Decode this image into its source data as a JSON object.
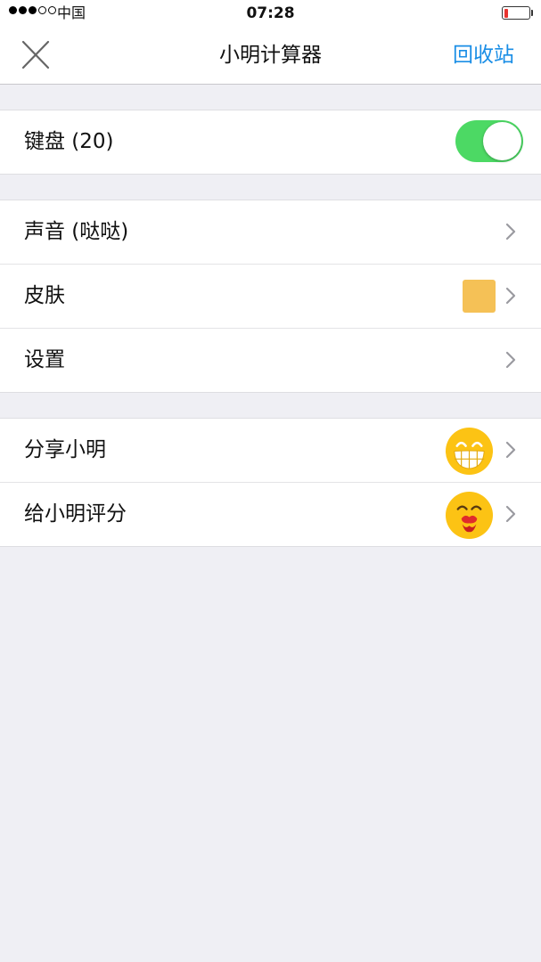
{
  "status_bar": {
    "carrier": "中国",
    "time": "07:28",
    "signal_filled": 3,
    "signal_total": 5,
    "battery_level": 0.1
  },
  "nav": {
    "title": "小明计算器",
    "right_action": "回收站",
    "left_icon": "close-icon",
    "accent_color": "#1a8ee6"
  },
  "groups": [
    {
      "rows": [
        {
          "label": "键盘 (20)",
          "control": "toggle",
          "toggle_on": true,
          "toggle_color": "#4cd964"
        }
      ]
    },
    {
      "rows": [
        {
          "label": "声音 (哒哒)",
          "control": "chevron"
        },
        {
          "label": "皮肤",
          "control": "chevron",
          "swatch_color": "#f5c156"
        },
        {
          "label": "设置",
          "control": "chevron"
        }
      ]
    },
    {
      "rows": [
        {
          "label": "分享小明",
          "control": "chevron",
          "icon": "grinning-emoji-icon"
        },
        {
          "label": "给小明评分",
          "control": "chevron",
          "icon": "kiss-emoji-icon"
        }
      ]
    }
  ]
}
